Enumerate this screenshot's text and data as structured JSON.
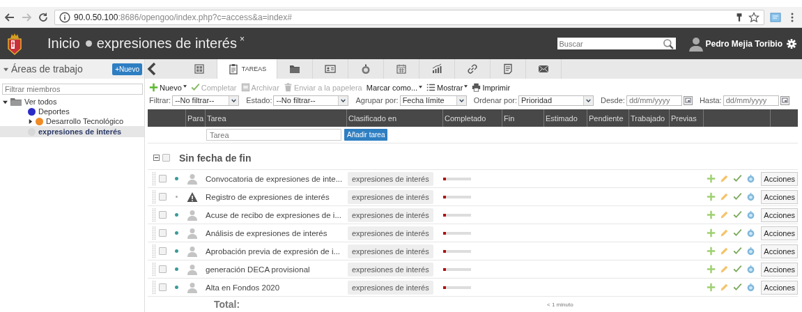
{
  "browser": {
    "url_host": "90.0.50.100",
    "url_rest": ":8686/opengoo/index.php?c=access&a=index#"
  },
  "header": {
    "home": "Inicio",
    "workspace": "expresiones de interés",
    "close": "×",
    "search": {
      "placeholder": "Buscar"
    },
    "user": "Pedro Mejia Toribio"
  },
  "sidebar": {
    "title": "Áreas de trabajo",
    "new_button": "+Nuevo",
    "filter": {
      "placeholder": "Filtrar miembros"
    },
    "tree": [
      {
        "label": "Ver todos",
        "expanded": true,
        "selected": false,
        "children": [
          {
            "label": "Deportes",
            "color": "#2b2bc8",
            "selected": false
          },
          {
            "label": "Desarrollo Tecnológico",
            "color": "#f08a24",
            "expanded": false,
            "selected": false
          },
          {
            "label": "expresiones de interés",
            "color": "#d8d8d8",
            "selected": true
          }
        ]
      }
    ]
  },
  "tabs": [
    {
      "kind": "grid",
      "selected": false
    },
    {
      "kind": "tasks",
      "label": "TAREAS",
      "selected": true
    },
    {
      "kind": "folder",
      "selected": false
    },
    {
      "kind": "contact",
      "selected": false
    },
    {
      "kind": "timer",
      "selected": false
    },
    {
      "kind": "calendar",
      "selected": false
    },
    {
      "kind": "chart",
      "selected": false
    },
    {
      "kind": "link",
      "selected": false
    },
    {
      "kind": "note",
      "selected": false
    },
    {
      "kind": "mail",
      "selected": false
    }
  ],
  "toolbar": [
    {
      "kind": "new",
      "label": "Nuevo",
      "dropdown": true,
      "disabled": false
    },
    {
      "kind": "complete",
      "label": "Completar",
      "dropdown": false,
      "disabled": true
    },
    {
      "kind": "archive",
      "label": "Archivar",
      "dropdown": false,
      "disabled": true
    },
    {
      "kind": "trash",
      "label": "Enviar a la papelera",
      "dropdown": false,
      "disabled": true
    },
    {
      "kind": "mark",
      "label": "Marcar como...",
      "dropdown": true,
      "disabled": false
    },
    {
      "kind": "show",
      "label": "Mostrar",
      "dropdown": true,
      "disabled": false
    },
    {
      "kind": "print",
      "label": "Imprimir",
      "dropdown": false,
      "disabled": false
    }
  ],
  "filters": [
    {
      "kind": "select",
      "label": "Filtrar:",
      "value": "--No filtrar--"
    },
    {
      "kind": "select",
      "label": "Estado:",
      "value": "--No filtrar--"
    },
    {
      "kind": "select",
      "label": "Agrupar por:",
      "value": "Fecha límite"
    },
    {
      "kind": "select",
      "label": "Ordenar por:",
      "value": "Prioridad"
    },
    {
      "kind": "date",
      "label": "Desde:",
      "placeholder": "dd/mm/yyyy"
    },
    {
      "kind": "date",
      "label": "Hasta:",
      "placeholder": "dd/mm/yyyy"
    }
  ],
  "table": {
    "columns": [
      "Para",
      "Tarea",
      "Clasificado en",
      "Completado",
      "Fin",
      "Estimado",
      "Pendiente",
      "Trabajado",
      "Previas"
    ],
    "quick_add": {
      "placeholder": "Tarea",
      "button": "Añadir tarea"
    },
    "group": {
      "title": "Sin fecha de fin",
      "expanded": true,
      "checked": false
    },
    "rows": [
      {
        "kind": "person",
        "title": "Convocatoria de expresiones de inte...",
        "workspace": "expresiones de interés",
        "level": 0.12,
        "color": "#3a9a9a",
        "checked": false,
        "actions": "Acciones"
      },
      {
        "kind": "warning",
        "title": "Registro de expresiones de interés",
        "workspace": "expresiones de interés",
        "level": 0.12,
        "color": "#a8a8a8",
        "checked": false,
        "actions": "Acciones"
      },
      {
        "kind": "person",
        "title": "Acuse de recibo de expresiones de i...",
        "workspace": "expresiones de interés",
        "level": 0.12,
        "color": "#3a9a9a",
        "checked": false,
        "actions": "Acciones"
      },
      {
        "kind": "person",
        "title": "Análisis de expresiones de interés",
        "workspace": "expresiones de interés",
        "level": 0.12,
        "color": "#3a9a9a",
        "checked": false,
        "actions": "Acciones"
      },
      {
        "kind": "person",
        "title": "Aprobación previa de expresión de i...",
        "workspace": "expresiones de interés",
        "level": 0.12,
        "color": "#3a9a9a",
        "checked": false,
        "actions": "Acciones"
      },
      {
        "kind": "person",
        "title": "generación DECA provisional",
        "workspace": "expresiones de interés",
        "level": 0.12,
        "color": "#3a9a9a",
        "checked": false,
        "actions": "Acciones"
      },
      {
        "kind": "person",
        "title": "Alta en Fondos 2020",
        "workspace": "expresiones de interés",
        "level": 0.12,
        "color": "#3a9a9a",
        "checked": false,
        "actions": "Acciones"
      }
    ],
    "total": {
      "label": "Total:",
      "estimated": "< 1 minuto"
    }
  }
}
